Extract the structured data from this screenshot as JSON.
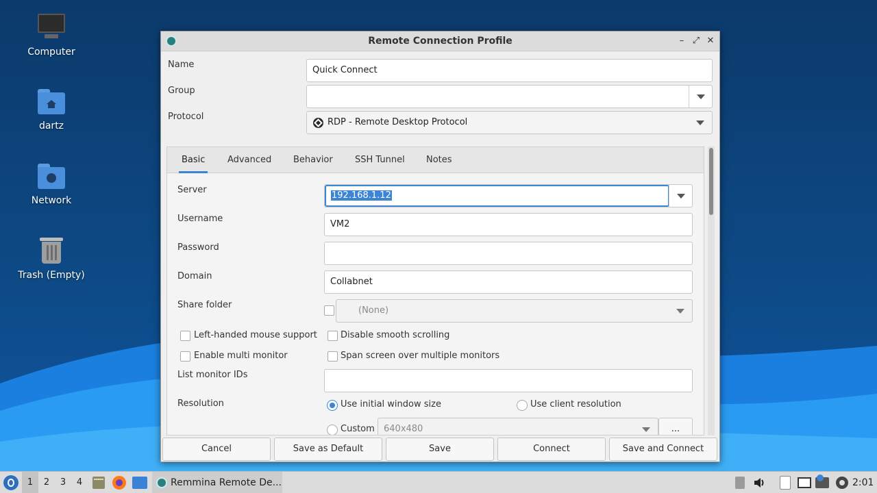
{
  "desktop": {
    "icons": [
      {
        "label": "Computer",
        "icon": "computer-icon"
      },
      {
        "label": "dartz",
        "icon": "home-folder-icon"
      },
      {
        "label": "Network",
        "icon": "network-folder-icon"
      },
      {
        "label": "Trash (Empty)",
        "icon": "trash-icon"
      }
    ]
  },
  "window": {
    "title": "Remote Connection Profile",
    "controls": {
      "minimize": "–",
      "maximize": "⤢",
      "close": "✕"
    },
    "name": {
      "label": "Name",
      "value": "Quick Connect"
    },
    "group": {
      "label": "Group",
      "value": ""
    },
    "protocol": {
      "label": "Protocol",
      "value": "RDP - Remote Desktop Protocol"
    },
    "tabs": [
      "Basic",
      "Advanced",
      "Behavior",
      "SSH Tunnel",
      "Notes"
    ],
    "active_tab": "Basic",
    "basic": {
      "server": {
        "label": "Server",
        "value": "192.168.1.12"
      },
      "username": {
        "label": "Username",
        "value": "VM2"
      },
      "password": {
        "label": "Password",
        "value": ""
      },
      "domain": {
        "label": "Domain",
        "value": "Collabnet"
      },
      "share_folder": {
        "label": "Share folder",
        "value": "(None)"
      },
      "left_handed": "Left-handed mouse support",
      "disable_smooth": "Disable smooth scrolling",
      "multi_monitor": "Enable multi monitor",
      "span_screen": "Span screen over multiple monitors",
      "monitor_ids": {
        "label": "List monitor IDs",
        "value": ""
      },
      "resolution": {
        "label": "Resolution",
        "initial": "Use initial window size",
        "client": "Use client resolution",
        "custom": "Custom",
        "custom_value": "640x480",
        "more": "..."
      }
    },
    "buttons": {
      "cancel": "Cancel",
      "save_default": "Save as Default",
      "save": "Save",
      "connect": "Connect",
      "save_connect": "Save and Connect"
    }
  },
  "taskbar": {
    "workspaces": [
      "1",
      "2",
      "3",
      "4"
    ],
    "active_workspace": "1",
    "task": "Remmina Remote De...",
    "clock": "2:01"
  },
  "colors": {
    "accent": "#3c84d4",
    "selection": "#3c84d4"
  }
}
